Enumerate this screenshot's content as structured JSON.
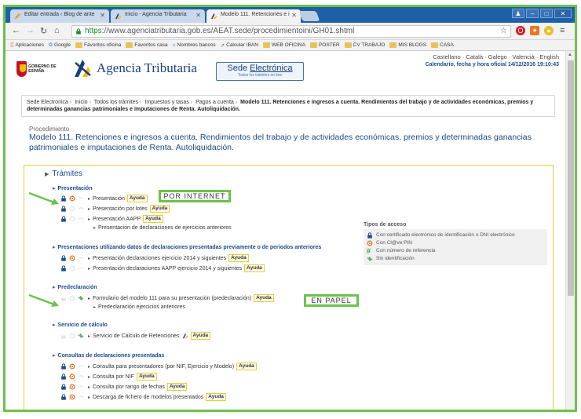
{
  "browser": {
    "tabs": [
      {
        "label": "Editar entrada ‹ Blog de ante"
      },
      {
        "label": "Inicio - Agencia Tributaria"
      },
      {
        "label": "Modelo 111. Retenciones e i"
      }
    ],
    "url_scheme": "https",
    "url_rest": "://www.agenciatributaria.gob.es/AEAT.sede/procedimientoini/GH01.shtml",
    "bookmarks": [
      "Aplicaciones",
      "Google",
      "Favoritos oficina",
      "Favoritos casa",
      "Nombres bancos",
      "Calcular IBAN",
      "WEB OFICINA",
      "POSTER",
      "CV TRABAJO",
      "MIS BLOGS",
      "CASA"
    ]
  },
  "header": {
    "gov_text": "GOBIERNO DE ESPAÑA",
    "agency_name": "Agencia Tributaria",
    "sede_prefix": "Sede ",
    "sede_underlined": "Electrónica",
    "sede_sub": "Todos los trámites on line",
    "languages": "Castellano · Català · Galego · Valencià · English",
    "datetime": "Calendario, fecha y hora oficial 14/12/2016 19:10:43"
  },
  "breadcrumb": {
    "items": [
      "Sede Electrónica",
      "Inicio",
      "Todos los trámites",
      "Impuestos y tasas",
      "Pagos a cuenta"
    ],
    "current": "Modelo 111. Retenciones e ingresos a cuenta. Rendimientos del trabajo y de actividades económicas, premios y determinadas ganancias patrimoniales e imputaciones de Renta. Autoliquidación."
  },
  "procedure": {
    "label": "Procedimiento",
    "title": "Modelo 111. Retenciones e ingresos a cuenta. Rendimientos del trabajo y de actividades económicas, premios y determinadas ganancias patrimoniales e imputaciones de Renta. Autoliquidación."
  },
  "tramites": {
    "heading": "Trámites",
    "ayuda": "Ayuda",
    "sections": [
      {
        "title": "Presentación",
        "rows": [
          "Presentación",
          "Presentación por lotes",
          "Presentación AAPP",
          "Presentación de declaraciones de ejercicios anteriores"
        ]
      },
      {
        "title": "Presentaciones utilizando datos de declaraciones presentadas previamente o de periodos anteriores",
        "rows": [
          "Presentación declaraciones ejercicio 2014 y siguientes",
          "Presentación declaraciones AAPP ejercicio 2014 y siguientes"
        ]
      },
      {
        "title": "Predeclaración",
        "rows": [
          "Formulario del modelo 111 para su presentación (predeclaración)",
          "Predeclaración ejercicios anteriores"
        ]
      },
      {
        "title": "Servicio de cálculo",
        "rows": [
          "Servicio de Cálculo de Retenciones"
        ]
      },
      {
        "title": "Consultas de declaraciones presentadas",
        "rows": [
          "Consulta para presentadores (por NIF, Ejercicio y Modelo)",
          "Consulta por NIF",
          "Consulta por rango de fechas",
          "Descarga de fichero de modelos presentados"
        ]
      }
    ]
  },
  "access_types": {
    "heading": "Tipos de acceso",
    "items": [
      "Con certificado electrónico de identificación o DNI electrónico",
      "Con Cl@ve PIN",
      "Con número de referencia",
      "Sin identificación"
    ]
  },
  "callouts": {
    "internet": "POR INTERNET",
    "papel": "EN PAPEL"
  },
  "colors": {
    "highlight": "#6cc24a",
    "link": "#1a4a8a",
    "ayuda_border": "#e8cc3a",
    "tab_bar": "#1e5fa8"
  }
}
